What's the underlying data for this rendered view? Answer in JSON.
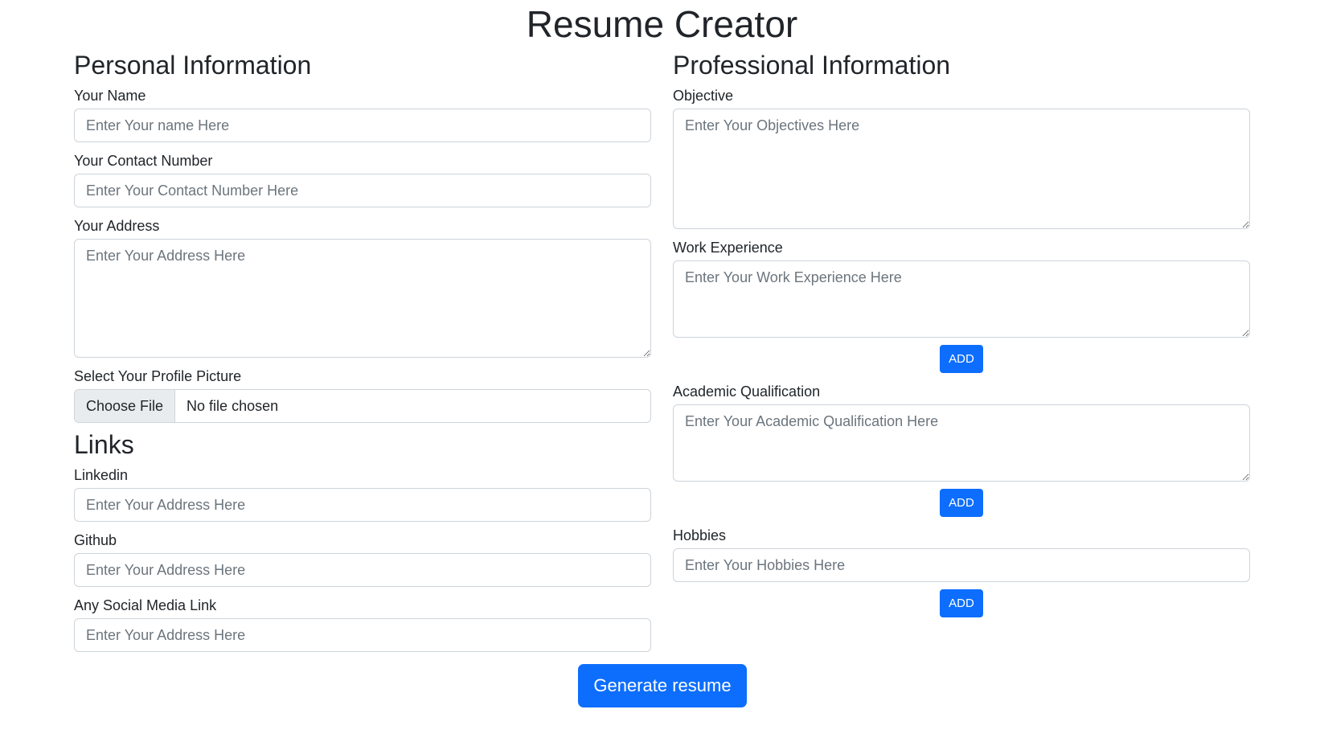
{
  "title": "Resume Creator",
  "personal": {
    "heading": "Personal Information",
    "name": {
      "label": "Your Name",
      "placeholder": "Enter Your name Here"
    },
    "contact": {
      "label": "Your Contact Number",
      "placeholder": "Enter Your Contact Number Here"
    },
    "address": {
      "label": "Your Address",
      "placeholder": "Enter Your Address Here"
    },
    "picture": {
      "label": "Select Your Profile Picture",
      "button": "Choose File",
      "status": "No file chosen"
    }
  },
  "links": {
    "heading": "Links",
    "linkedin": {
      "label": "Linkedin",
      "placeholder": "Enter Your Address Here"
    },
    "github": {
      "label": "Github",
      "placeholder": "Enter Your Address Here"
    },
    "social": {
      "label": "Any Social Media Link",
      "placeholder": "Enter Your Address Here"
    }
  },
  "professional": {
    "heading": "Professional Information",
    "objective": {
      "label": "Objective",
      "placeholder": "Enter Your Objectives Here"
    },
    "work": {
      "label": "Work Experience",
      "placeholder": "Enter Your Work Experience Here",
      "add": "ADD"
    },
    "academic": {
      "label": "Academic Qualification",
      "placeholder": "Enter Your Academic Qualification Here",
      "add": "ADD"
    },
    "hobbies": {
      "label": "Hobbies",
      "placeholder": "Enter Your Hobbies Here",
      "add": "ADD"
    }
  },
  "generate_label": "Generate resume",
  "colors": {
    "primary": "#0d6efd",
    "border": "#ced4da",
    "text": "#212529",
    "placeholder": "#6c757d"
  }
}
